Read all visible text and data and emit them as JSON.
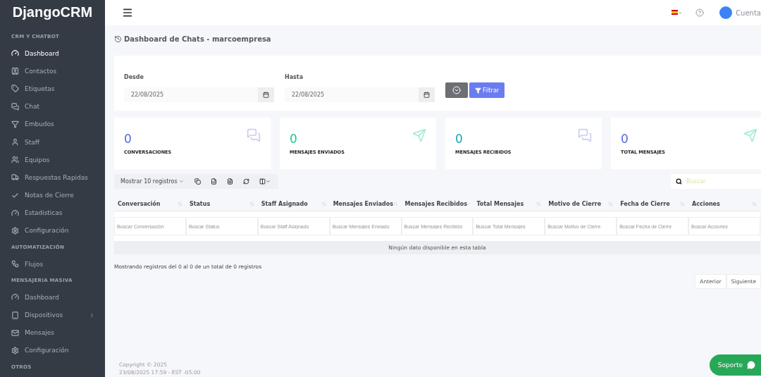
{
  "brand": "DjangoCRM",
  "sidebar": {
    "sections": [
      {
        "title": "CRM Y CHATBOT",
        "items": [
          {
            "label": "Dashboard",
            "selected": true,
            "kind": "link"
          },
          {
            "label": "Contactos",
            "selected": false,
            "kind": "link"
          },
          {
            "label": "Etiquetas",
            "selected": false,
            "kind": "link"
          },
          {
            "label": "Chat",
            "selected": false,
            "kind": "link"
          },
          {
            "label": "Embudos",
            "selected": false,
            "kind": "link"
          },
          {
            "label": "Staff",
            "selected": false,
            "kind": "link"
          },
          {
            "label": "Equipos",
            "selected": false,
            "kind": "link"
          },
          {
            "label": "Respuestas Rapidas",
            "selected": false,
            "kind": "link"
          },
          {
            "label": "Notas de Cierre",
            "selected": false,
            "kind": "link"
          },
          {
            "label": "Estadisticas",
            "selected": false,
            "kind": "link"
          },
          {
            "label": "Configuración",
            "selected": false,
            "kind": "link"
          }
        ]
      },
      {
        "title": "AUTOMATIZACIÓN",
        "items": [
          {
            "label": "Flujos",
            "selected": false,
            "kind": "link"
          }
        ]
      },
      {
        "title": "MENSAJERIA MASIVA",
        "items": [
          {
            "label": "Dashboard",
            "selected": false,
            "kind": "link"
          },
          {
            "label": "Dispositivos",
            "selected": false,
            "kind": "submenu"
          },
          {
            "label": "Mensajes",
            "selected": false,
            "kind": "link"
          },
          {
            "label": "Configuración",
            "selected": false,
            "kind": "link"
          }
        ]
      },
      {
        "title": "OTROS"
      }
    ]
  },
  "topbar": {
    "account_label": "Cuenta"
  },
  "page_title": "Dashboard de Chats - marcoempresa",
  "filters": {
    "from": {
      "label": "Desde",
      "value": "22/08/2025"
    },
    "to": {
      "label": "Hasta",
      "value": "22/08/2025"
    },
    "filter_button": "Filtrar"
  },
  "stats": [
    {
      "value": "0",
      "label": "CONVERSACIONES",
      "color": "#5a67d8"
    },
    {
      "value": "0",
      "label": "MENSAJES ENVIADOS",
      "color": "#1cc88a"
    },
    {
      "value": "0",
      "label": "MENSAJES RECIBIDOS",
      "color": "#17a2b8"
    },
    {
      "value": "0",
      "label": "TOTAL MENSAJES",
      "color": "#5a67d8"
    }
  ],
  "table": {
    "length_menu": "Mostrar 10 registros",
    "search_placeholder": "Buscar",
    "columns": [
      {
        "title": "Conversación",
        "filter_placeholder": "Buscar Conversación"
      },
      {
        "title": "Status",
        "filter_placeholder": "Buscar Status"
      },
      {
        "title": "Staff Asignado",
        "filter_placeholder": "Buscar Staff Asignado"
      },
      {
        "title": "Mensajes Enviados",
        "filter_placeholder": "Buscar Mensajes Enviado"
      },
      {
        "title": "Mensajes Recibidos",
        "filter_placeholder": "Buscar Mensajes Recibido"
      },
      {
        "title": "Total Mensajes",
        "filter_placeholder": "Buscar Total Mensajes"
      },
      {
        "title": "Motivo de Cierre",
        "filter_placeholder": "Buscar Motivo de Cierre"
      },
      {
        "title": "Fecha de Cierre",
        "filter_placeholder": "Buscar Fecha de Cierre"
      },
      {
        "title": "Acciones",
        "filter_placeholder": "Buscar Acciones"
      }
    ],
    "empty_message": "Ningún dato disponible en esta tabla",
    "info": "Mostrando registros del 0 al 0 de un total de 0 registros",
    "pagination": [
      "Anterior",
      "Siguiente"
    ]
  },
  "footer": {
    "copyright": "Copyright © 2025",
    "timestamp": "23/08/2025 17:59 - EST -05:00"
  },
  "support_button": "Soporte"
}
